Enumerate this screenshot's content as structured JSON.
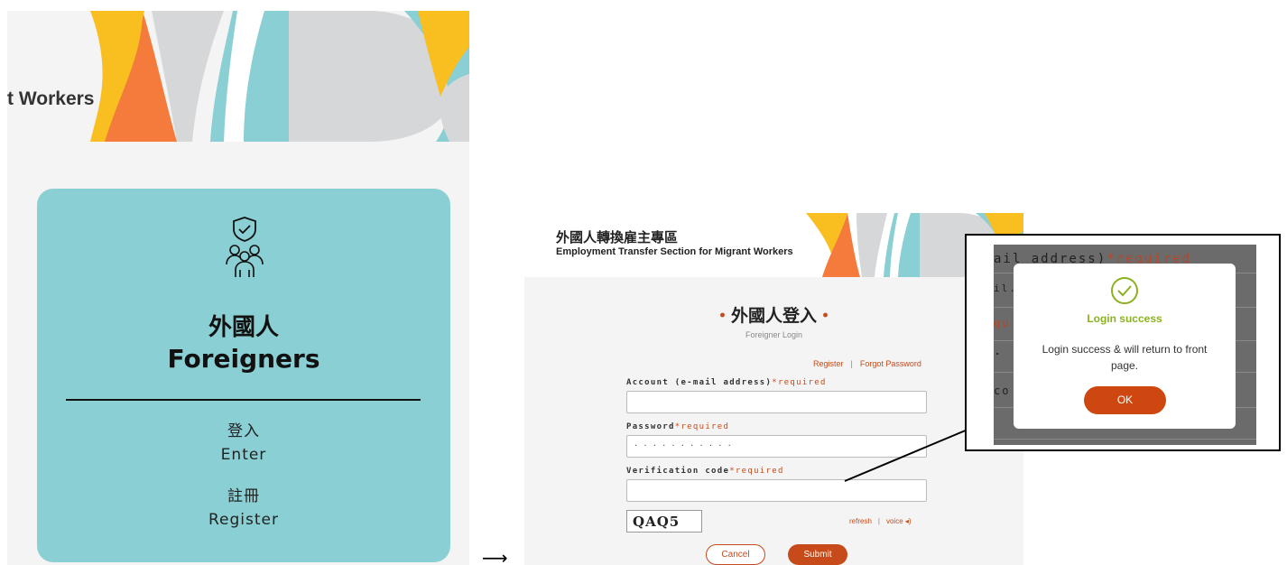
{
  "left_panel": {
    "banner_title": "t Workers",
    "card": {
      "icon": "shield-people-icon",
      "title_zh": "外國人",
      "title_en": "Foreigners",
      "enter_zh": "登入",
      "enter_en": "Enter",
      "register_zh": "註冊",
      "register_en": "Register"
    }
  },
  "arrow": "⟶",
  "login_page": {
    "header_zh": "外國人轉換雇主專區",
    "header_en": "Employment Transfer Section for Migrant Workers",
    "title_dot_left": "・",
    "title": "外國人登入",
    "title_dot_right": "・",
    "subtitle": "Foreigner Login",
    "register_link": "Register",
    "link_separator": "|",
    "forgot_link": "Forgot Password",
    "account_label": "Account (e-mail address)",
    "required_mark": "*required",
    "account_value": "",
    "password_label": "Password",
    "password_value": "· · · · · · · · · · ·",
    "verification_label": "Verification code",
    "verification_value": "",
    "captcha_text": "QAQ5",
    "refresh_link": "refresh",
    "voice_link": "voice ◂)",
    "cancel_button": "Cancel",
    "submit_button": "Submit"
  },
  "zoom": {
    "bg_fragments": {
      "email": "ail address)",
      "req": "*required",
      "com": "il.co",
      "req2": "qu",
      "dots": "· ·",
      "co": "co"
    },
    "modal": {
      "icon": "check-circle-icon",
      "title": "Login success",
      "message": "Login success & will return to front page.",
      "ok_button": "OK"
    }
  },
  "colors": {
    "card_teal": "#8acfd3",
    "accent_orange": "#c74a1a",
    "success_green": "#8bb21e",
    "banner_yellow": "#f9be1f",
    "banner_orange": "#f47b3b",
    "banner_gray": "#d6d7d9",
    "banner_teal": "#8acfd3"
  }
}
